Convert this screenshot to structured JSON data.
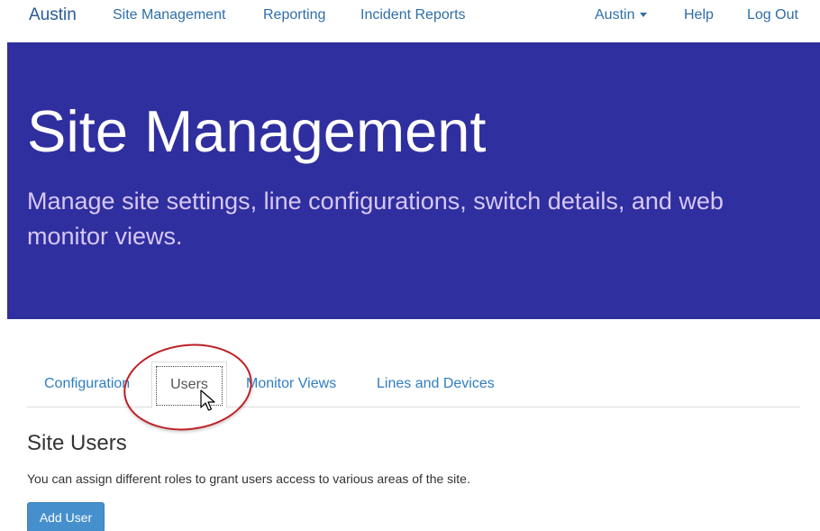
{
  "nav": {
    "brand": "Austin",
    "items": [
      "Site Management",
      "Reporting",
      "Incident Reports"
    ],
    "user_menu": "Austin",
    "help": "Help",
    "logout": "Log Out"
  },
  "hero": {
    "title": "Site Management",
    "subtitle": "Manage site settings, line configurations, switch details, and web monitor views."
  },
  "tabs": {
    "items": [
      "Configuration",
      "Users",
      "Monitor Views",
      "Lines and Devices"
    ],
    "active": "Users"
  },
  "section": {
    "title": "Site Users",
    "description": "You can assign different roles to grant users access to various areas of the site.",
    "add_button": "Add User"
  },
  "colors": {
    "hero_bg": "#2f2f9f",
    "link": "#2f7ec0",
    "button": "#4590cc",
    "highlight": "#bd2027"
  },
  "icons": [
    "chevron-down-icon",
    "mouse-pointer-icon"
  ]
}
